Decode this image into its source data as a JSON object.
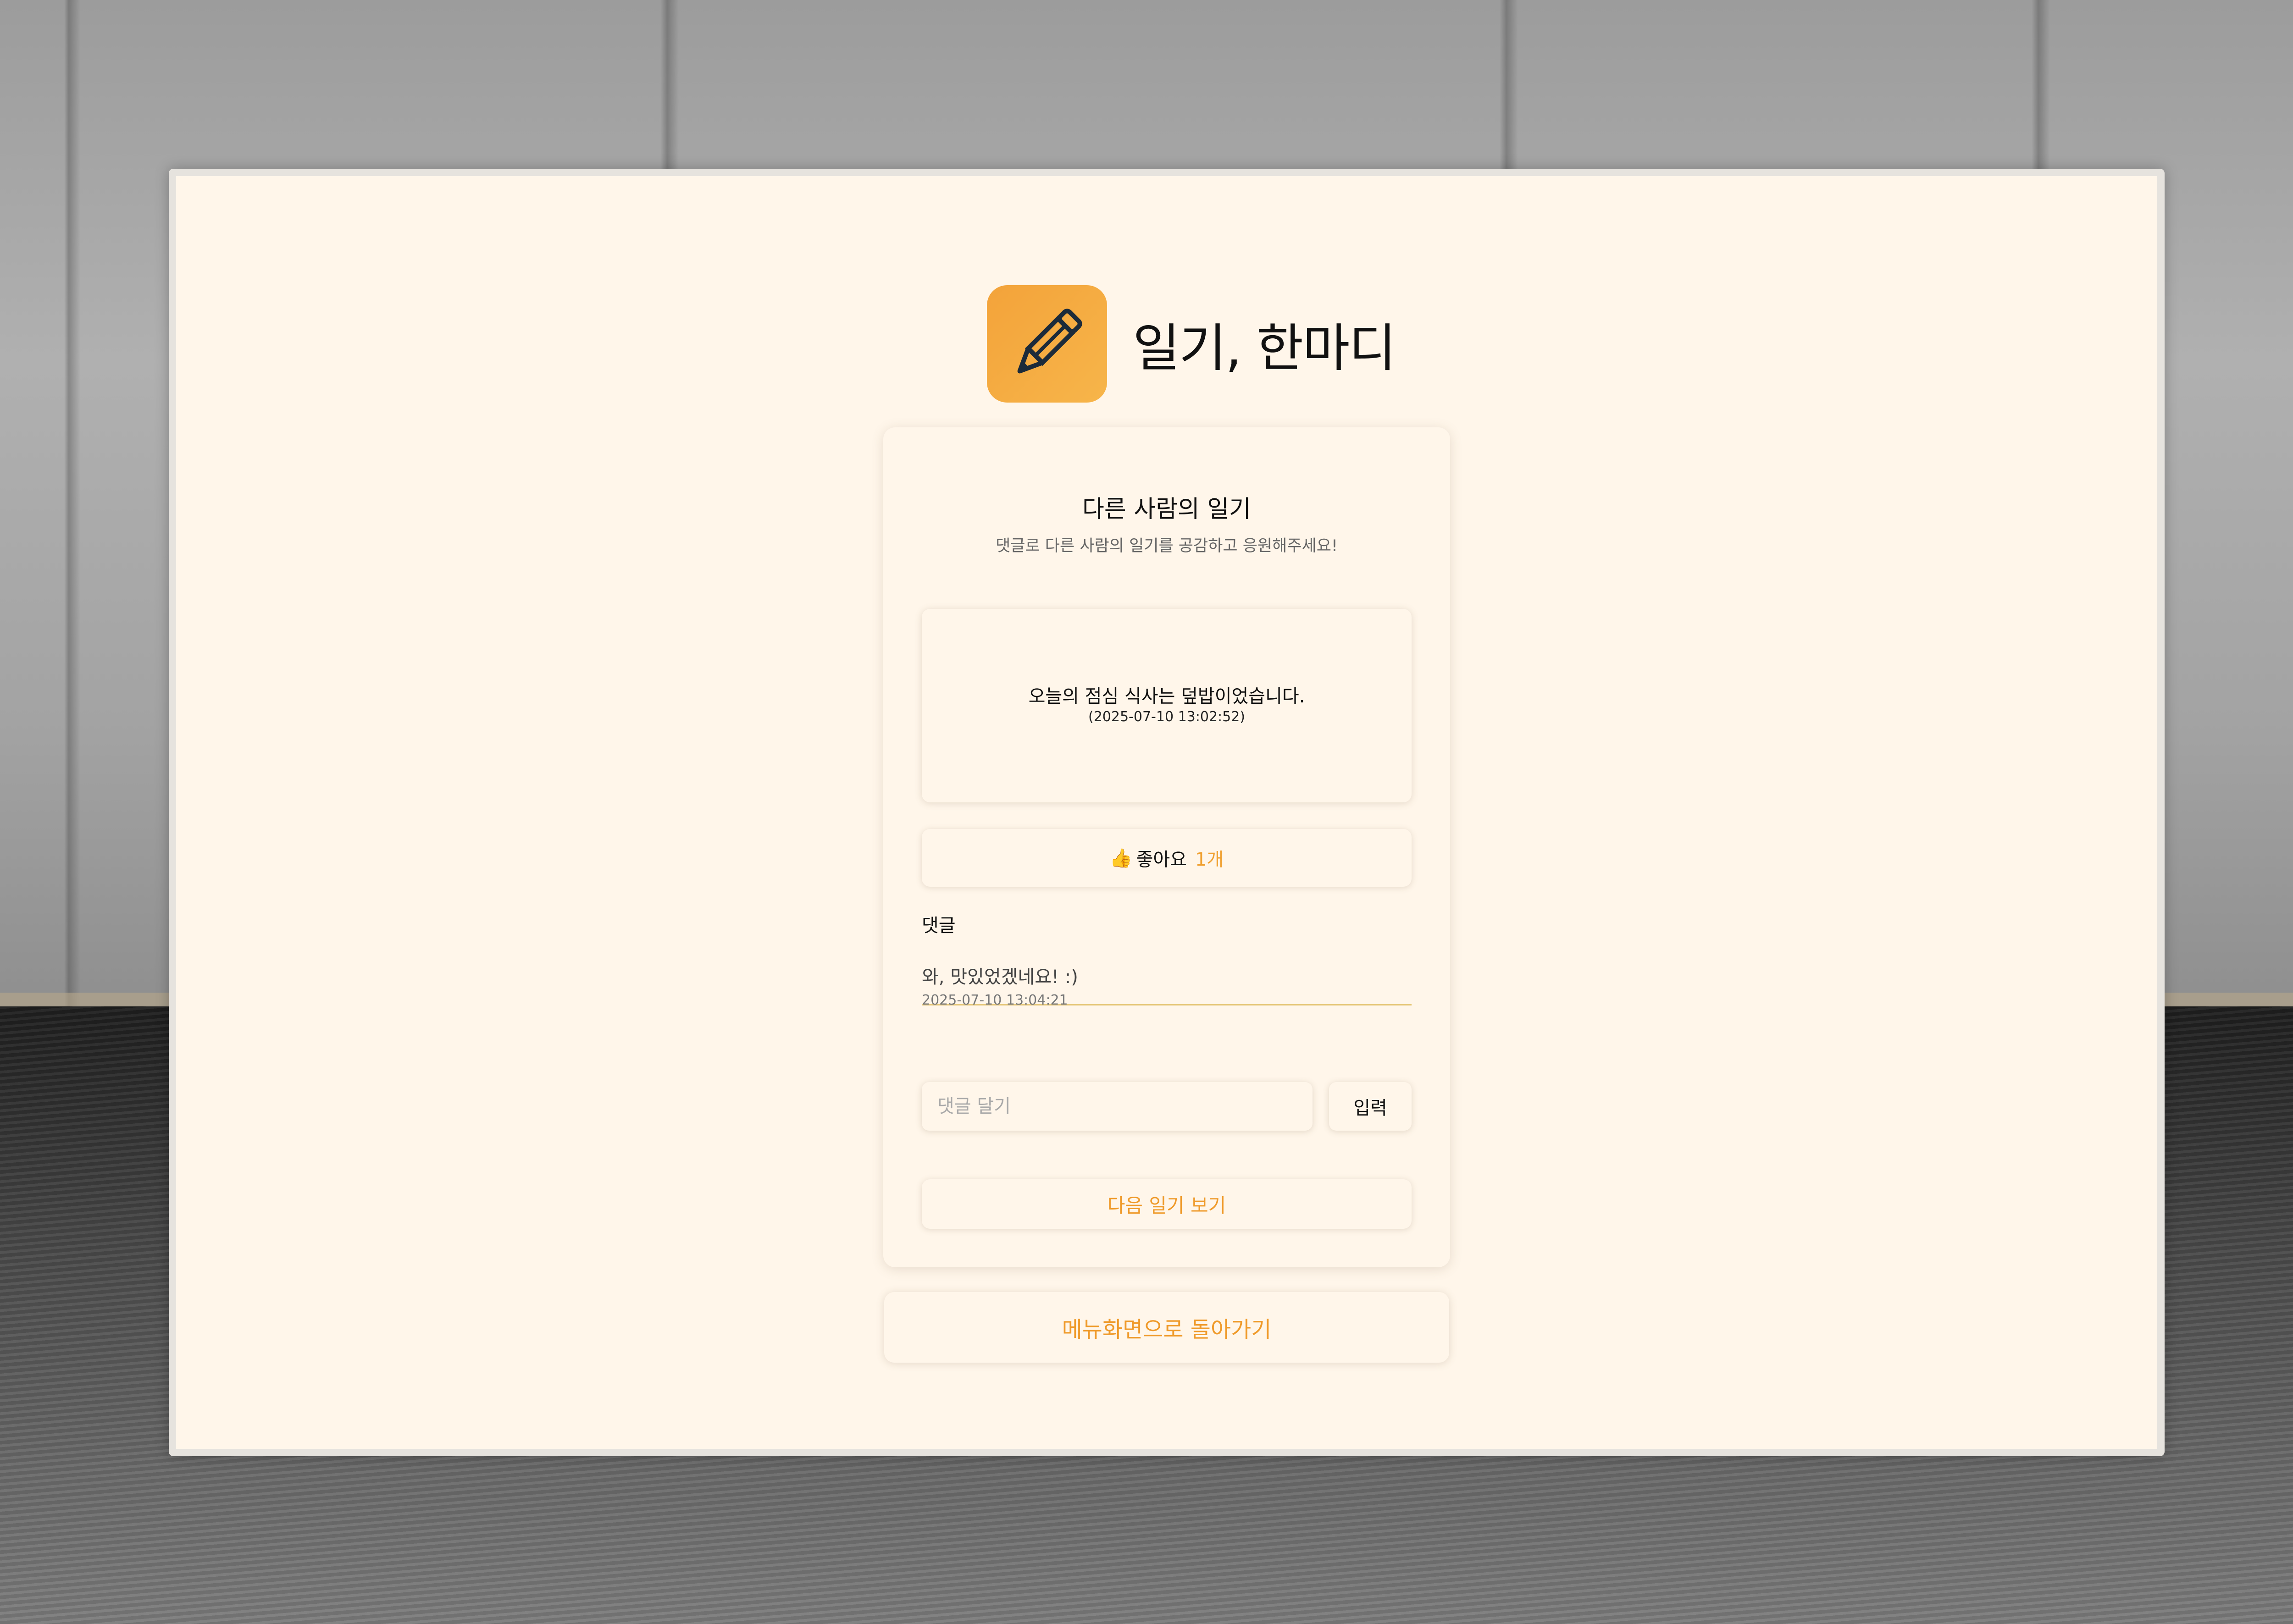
{
  "app": {
    "title": "일기, 한마디",
    "icon": "pencil-icon",
    "accent_color": "#F3A33A"
  },
  "page": {
    "title": "다른 사람의 일기",
    "subtitle": "댓글로 다른 사람의 일기를 공감하고 응원해주세요!"
  },
  "diary": {
    "text": "오늘의 점심 식사는 덮밥이었습니다.",
    "timestamp": "(2025-07-10 13:02:52)"
  },
  "like": {
    "icon": "👍",
    "label": "좋아요",
    "count": "1개"
  },
  "comments": {
    "label": "댓글",
    "items": [
      {
        "text": "와, 맛있었겠네요! :)",
        "timestamp": "2025-07-10 13:04:21"
      }
    ]
  },
  "comment_form": {
    "placeholder": "댓글 달기",
    "value": "",
    "submit_label": "입력"
  },
  "next_button": {
    "label": "다음 일기 보기"
  },
  "menu_button": {
    "label": "메뉴화면으로 돌아가기"
  }
}
